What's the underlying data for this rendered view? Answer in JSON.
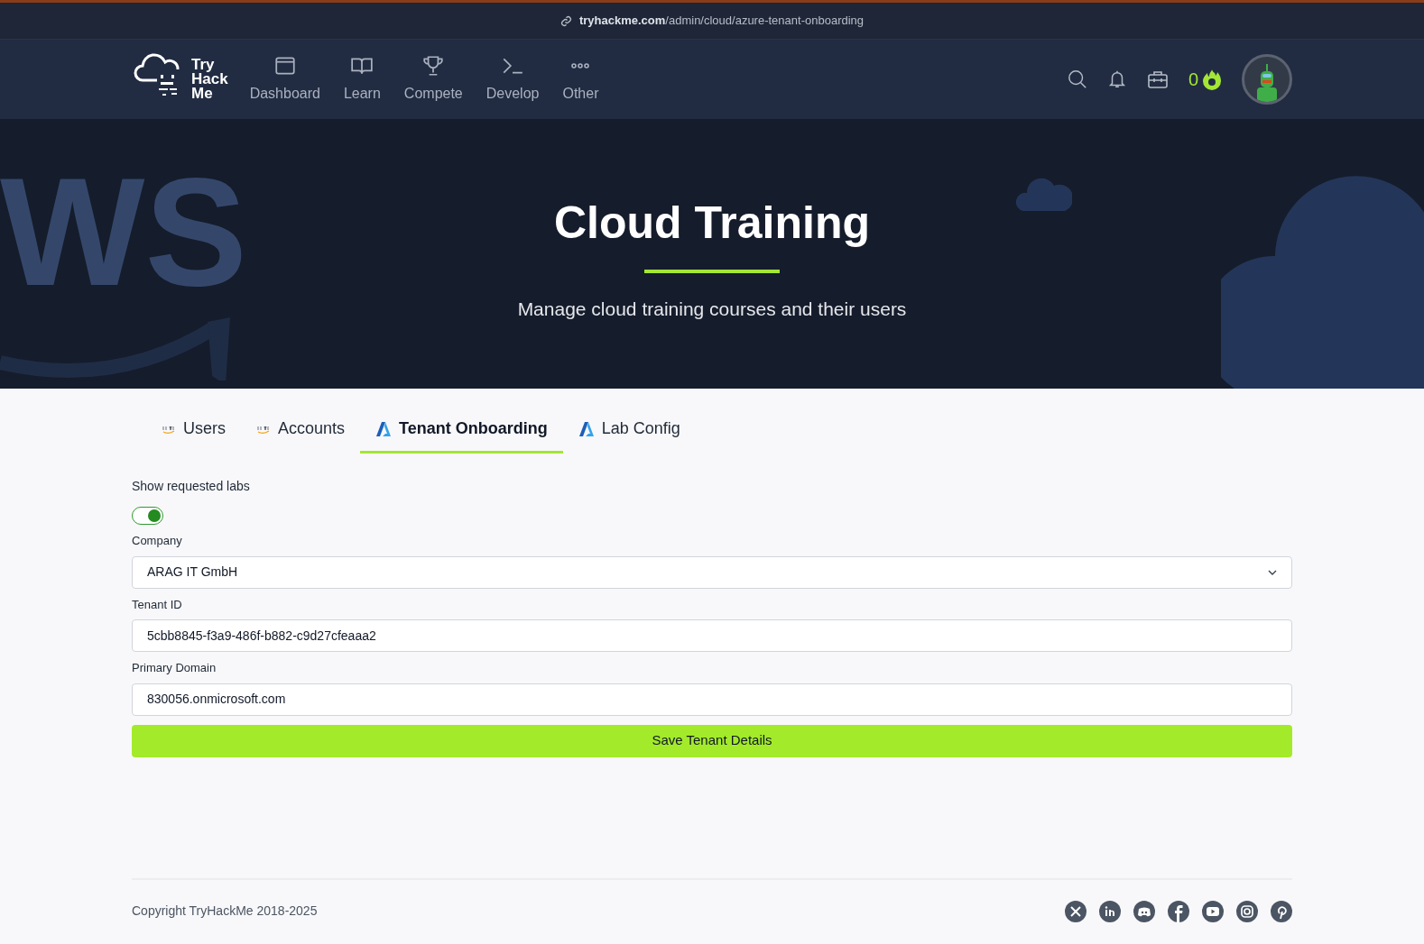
{
  "browser": {
    "url_host": "tryhackme.com",
    "url_path": "/admin/cloud/azure-tenant-onboarding"
  },
  "nav": {
    "logo": [
      "Try",
      "Hack",
      "Me"
    ],
    "items": [
      {
        "label": "Dashboard"
      },
      {
        "label": "Learn"
      },
      {
        "label": "Compete"
      },
      {
        "label": "Develop"
      },
      {
        "label": "Other"
      }
    ],
    "streak": "0"
  },
  "hero": {
    "background_text": "WS",
    "title": "Cloud Training",
    "subtitle": "Manage cloud training courses and their users"
  },
  "tabs": [
    {
      "label": "Users",
      "selected": false
    },
    {
      "label": "Accounts",
      "selected": false
    },
    {
      "label": "Tenant Onboarding",
      "selected": true
    },
    {
      "label": "Lab Config",
      "selected": false
    }
  ],
  "form": {
    "toggle": {
      "label": "Show requested labs",
      "on": true
    },
    "fields": [
      {
        "kind": "select",
        "label": "Company",
        "value": "ARAG IT GmbH"
      },
      {
        "kind": "text",
        "label": "Tenant ID",
        "value": "5cbb8845-f3a9-486f-b882-c9d27cfeaaa2"
      },
      {
        "kind": "text",
        "label": "Primary Domain",
        "value": "830056.onmicrosoft.com"
      }
    ],
    "submit": "Save Tenant Details"
  },
  "footer": {
    "copyright": "Copyright TryHackMe 2018-2025"
  }
}
